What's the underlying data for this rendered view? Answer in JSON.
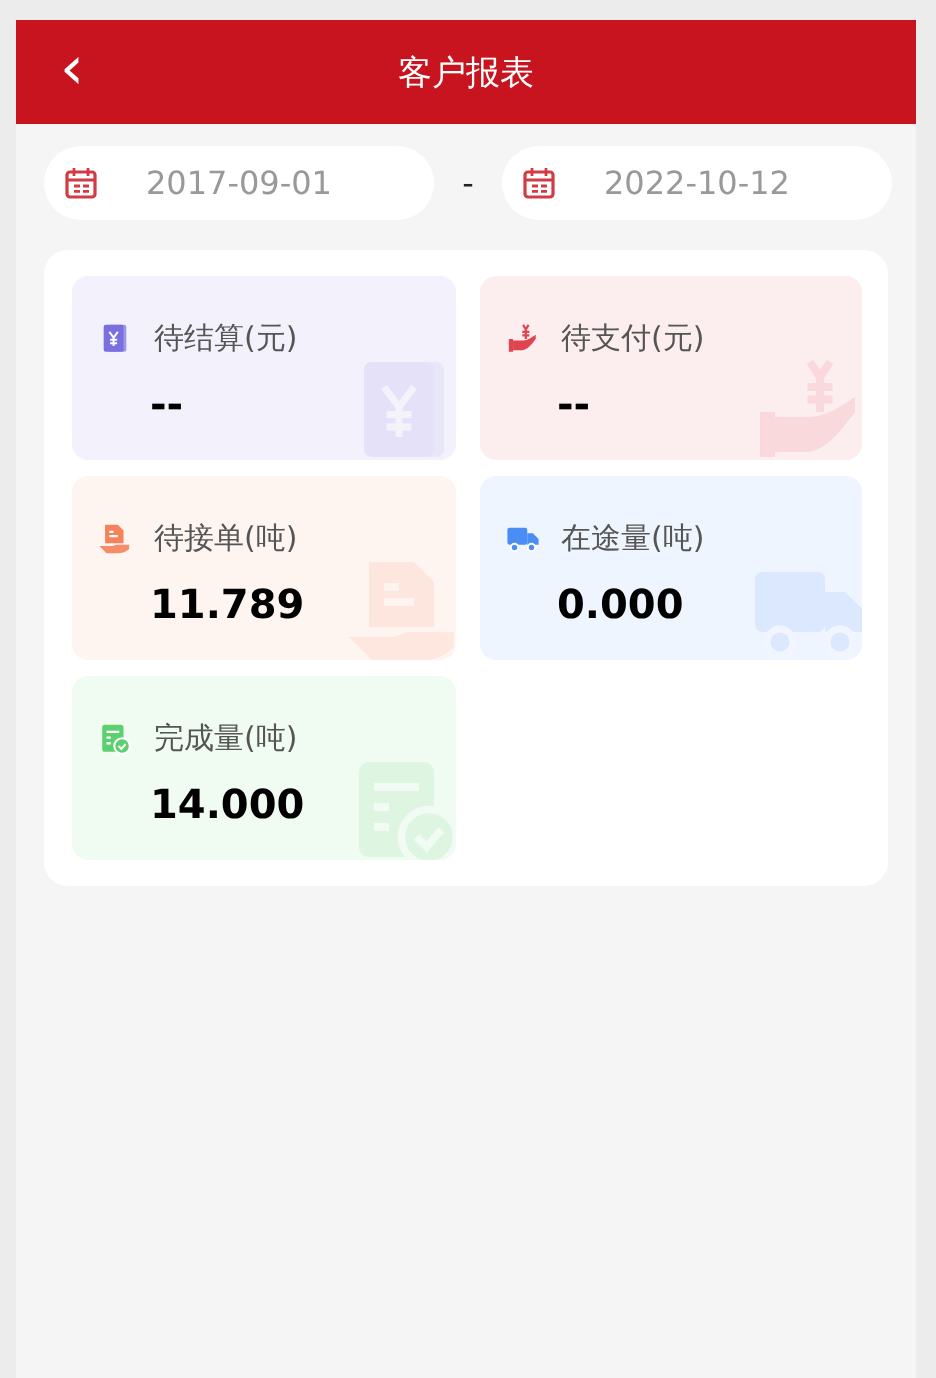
{
  "header": {
    "back_icon": "‹",
    "title": "客户报表"
  },
  "date_range": {
    "start": "2017-09-01",
    "separator": "-",
    "end": "2022-10-12"
  },
  "stats": [
    {
      "kind": "settle",
      "label": "待结算(元)",
      "value": "--",
      "color": "#7b6fe0"
    },
    {
      "kind": "pay",
      "label": "待支付(元)",
      "value": "--",
      "color": "#e0454f"
    },
    {
      "kind": "receive",
      "label": "待接单(吨)",
      "value": "11.789",
      "color": "#f5825a"
    },
    {
      "kind": "transit",
      "label": "在途量(吨)",
      "value": "0.000",
      "color": "#4a8ef5"
    },
    {
      "kind": "done",
      "label": "完成量(吨)",
      "value": "14.000",
      "color": "#5ccf6e"
    }
  ]
}
